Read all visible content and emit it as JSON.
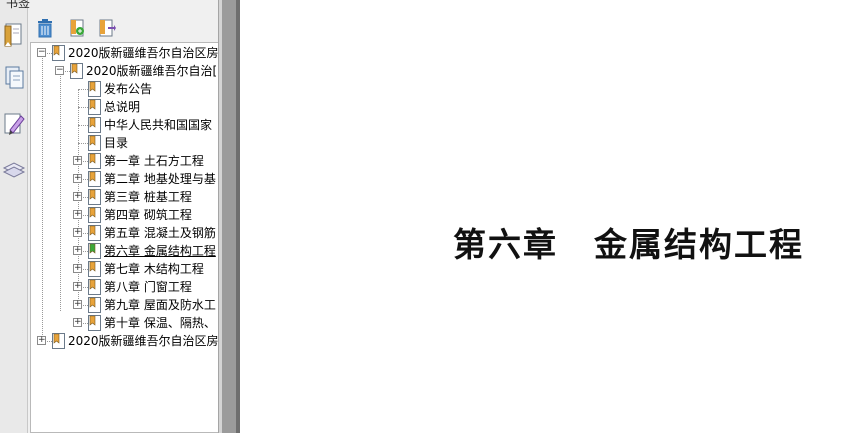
{
  "panel": {
    "title": "书签",
    "collapse_glyph": "«"
  },
  "toolbar": {
    "buttons": [
      {
        "name": "delete-bookmark-button",
        "icon": "trash-icon"
      },
      {
        "name": "new-bookmark-button",
        "icon": "new-bookmark-icon"
      },
      {
        "name": "bookmark-properties-button",
        "icon": "bookmark-arrow-icon"
      }
    ]
  },
  "strip": {
    "buttons": [
      {
        "name": "bookmarks-panel-button",
        "icon": "bookmark-page-icon"
      },
      {
        "name": "pages-panel-button",
        "icon": "pages-icon"
      },
      {
        "name": "annotations-panel-button",
        "icon": "pencil-icon"
      },
      {
        "name": "layers-panel-button",
        "icon": "layers-icon"
      }
    ]
  },
  "tree": {
    "items": [
      {
        "label": "2020版新疆维吾尔自治区房",
        "level": 0,
        "expander": "−",
        "icon": "bookmark-icon"
      },
      {
        "label": "2020版新疆维吾尔自治[",
        "level": 1,
        "expander": "−",
        "icon": "bookmark-icon"
      },
      {
        "label": "发布公告",
        "level": 2,
        "expander": "",
        "icon": "bookmark-icon"
      },
      {
        "label": "总说明",
        "level": 2,
        "expander": "",
        "icon": "bookmark-icon"
      },
      {
        "label": "中华人民共和国国家",
        "level": 2,
        "expander": "",
        "icon": "bookmark-icon"
      },
      {
        "label": "目录",
        "level": 2,
        "expander": "",
        "icon": "bookmark-icon"
      },
      {
        "label": "第一章  土石方工程",
        "level": 2,
        "expander": "+",
        "icon": "bookmark-icon"
      },
      {
        "label": "第二章  地基处理与基",
        "level": 2,
        "expander": "+",
        "icon": "bookmark-icon"
      },
      {
        "label": "第三章  桩基工程",
        "level": 2,
        "expander": "+",
        "icon": "bookmark-icon"
      },
      {
        "label": "第四章  砌筑工程",
        "level": 2,
        "expander": "+",
        "icon": "bookmark-icon"
      },
      {
        "label": "第五章  混凝土及钢筋",
        "level": 2,
        "expander": "+",
        "icon": "bookmark-icon"
      },
      {
        "label": "第六章  金属结构工程",
        "level": 2,
        "expander": "+",
        "icon": "bookmark-current-icon",
        "selected": true
      },
      {
        "label": "第七章  木结构工程",
        "level": 2,
        "expander": "+",
        "icon": "bookmark-icon"
      },
      {
        "label": "第八章  门窗工程",
        "level": 2,
        "expander": "+",
        "icon": "bookmark-icon"
      },
      {
        "label": "第九章  屋面及防水工",
        "level": 2,
        "expander": "+",
        "icon": "bookmark-icon"
      },
      {
        "label": "第十章  保温、隔热、",
        "level": 2,
        "expander": "+",
        "icon": "bookmark-icon"
      },
      {
        "label": "2020版新疆维吾尔自治区房",
        "level": 0,
        "expander": "+",
        "icon": "bookmark-icon"
      }
    ]
  },
  "document": {
    "chapter_number": "第六章",
    "chapter_title": "金属结构工程"
  },
  "colors": {
    "bookmark_orange": "#e8a33a",
    "bookmark_green": "#3aa83a",
    "panel_bg": "#f0f0f0",
    "gutter": "#9b9b9b"
  }
}
